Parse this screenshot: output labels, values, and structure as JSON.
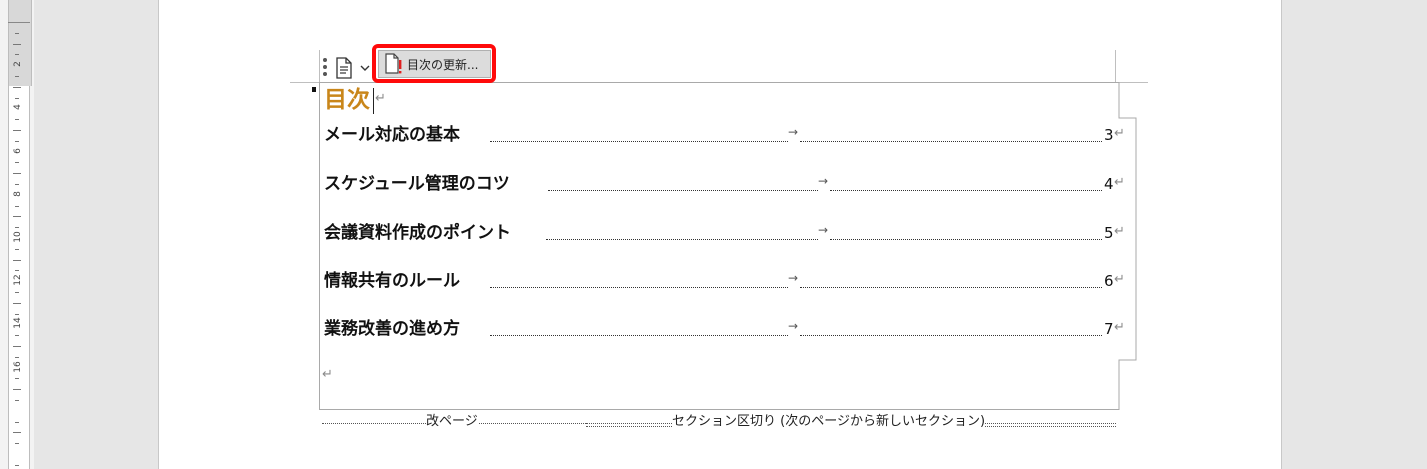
{
  "ruler": {
    "numbers": [
      "2",
      "4",
      "6",
      "8",
      "10",
      "12",
      "14",
      "16"
    ]
  },
  "toc_control": {
    "update_button_label": "目次の更新...",
    "menu_icon": "document-icon",
    "update_icon": "document-alert-icon"
  },
  "toc": {
    "title": "目次",
    "title_color": "#c9861a",
    "tab_glyph": "→",
    "para_glyph": "↵",
    "entries": [
      {
        "title": "メール対応の基本",
        "page": "3"
      },
      {
        "title": "スケジュール管理のコツ",
        "page": "4"
      },
      {
        "title": "会議資料作成のポイント",
        "page": "5"
      },
      {
        "title": "情報共有のルール",
        "page": "6"
      },
      {
        "title": "業務改善の進め方",
        "page": "7"
      }
    ]
  },
  "breaks": {
    "page_break": "改ページ",
    "section_break": "セクション区切り (次のページから新しいセクション)"
  },
  "colors": {
    "highlight": "#ff0a0a",
    "title_accent": "#c9861a"
  }
}
